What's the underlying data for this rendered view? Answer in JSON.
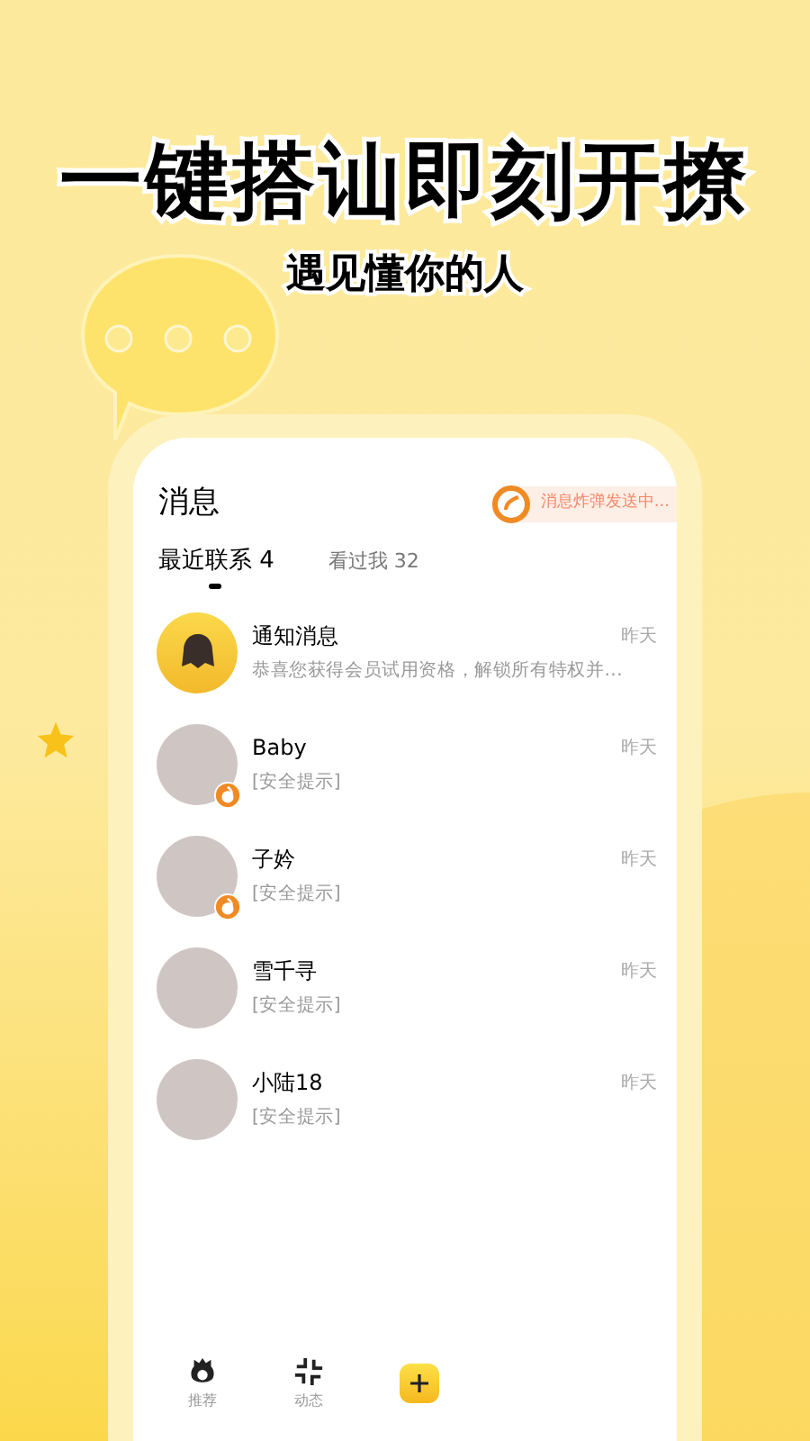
{
  "headline": "一键搭讪即刻开撩",
  "subtitle": "遇见懂你的人",
  "screen": {
    "title": "消息",
    "bomb_status": "消息炸弹发送中...",
    "tabs": [
      {
        "label": "最近联系",
        "count": "4",
        "selected": true
      },
      {
        "label": "看过我",
        "count": "32",
        "selected": false
      }
    ],
    "conversations": [
      {
        "kind": "notice",
        "name": "通知消息",
        "time": "昨天",
        "preview": "恭喜您获得会员试用资格，解锁所有特权并...",
        "badge": false
      },
      {
        "kind": "contact",
        "name": "Baby",
        "time": "昨天",
        "preview": "[安全提示]",
        "badge": true
      },
      {
        "kind": "contact",
        "name": "子妗",
        "time": "昨天",
        "preview": "[安全提示]",
        "badge": true
      },
      {
        "kind": "contact",
        "name": "雪千寻",
        "time": "昨天",
        "preview": "[安全提示]",
        "badge": false
      },
      {
        "kind": "contact",
        "name": "小陆18",
        "time": "昨天",
        "preview": "[安全提示]",
        "badge": false
      }
    ],
    "tab_bar": [
      {
        "kind": "recommend",
        "label": "推荐",
        "selected": false
      },
      {
        "kind": "moments",
        "label": "动态",
        "selected": false
      },
      {
        "kind": "plus"
      }
    ]
  }
}
